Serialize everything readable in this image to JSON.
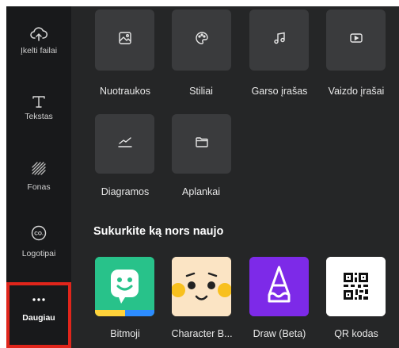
{
  "sidebar": {
    "items": [
      {
        "label": "Įkelti failai",
        "icon": "cloud-upload-icon"
      },
      {
        "label": "Tekstas",
        "icon": "text-icon"
      },
      {
        "label": "Fonas",
        "icon": "background-pattern-icon"
      },
      {
        "label": "Logotipai",
        "icon": "logo-icon"
      },
      {
        "label": "Daugiau",
        "icon": "more-dots-icon"
      }
    ],
    "highlight_color": "#e0251b"
  },
  "media_tiles": [
    {
      "label": "Nuotraukos",
      "icon": "image-icon"
    },
    {
      "label": "Stiliai",
      "icon": "palette-icon"
    },
    {
      "label": "Garso įrašas",
      "icon": "music-note-icon"
    },
    {
      "label": "Vaizdo įrašai",
      "icon": "video-icon"
    },
    {
      "label": "Diagramos",
      "icon": "line-chart-icon"
    },
    {
      "label": "Aplankai",
      "icon": "folder-icon"
    }
  ],
  "create_section": {
    "title": "Sukurkite ką nors naujo",
    "apps": [
      {
        "label": "Bitmoji",
        "icon": "bitmoji-icon",
        "color": "#28c28a"
      },
      {
        "label": "Character B...",
        "icon": "character-face-icon",
        "color": "#fbe4c4"
      },
      {
        "label": "Draw (Beta)",
        "icon": "draw-pencil-icon",
        "color": "#7d2ae8"
      },
      {
        "label": "QR kodas",
        "icon": "qr-code-icon",
        "color": "#ffffff"
      }
    ]
  },
  "colors": {
    "sidebar_bg": "#18191b",
    "panel_bg": "#252627",
    "tile_bg": "#3a3b3d"
  }
}
